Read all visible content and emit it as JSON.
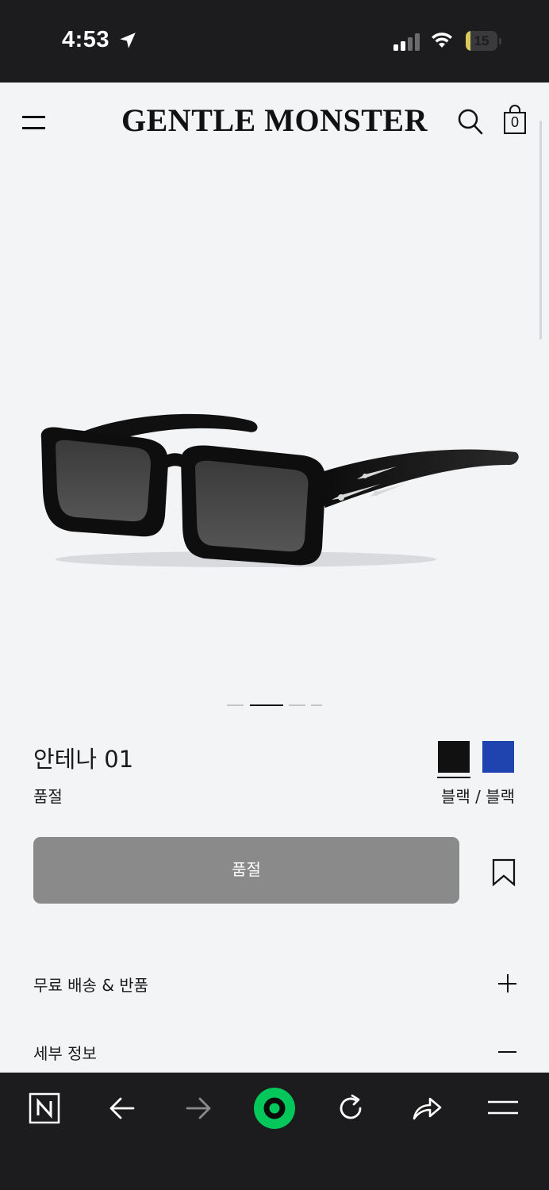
{
  "status_bar": {
    "time": "4:53",
    "battery_level": "15",
    "battery_fraction": 0.15,
    "icons": [
      "location-arrow-icon",
      "cellular-signal-icon",
      "wifi-icon",
      "battery-icon"
    ]
  },
  "header": {
    "logo": "GENTLE MONSTER",
    "cart_count": "0",
    "icons": [
      "hamburger-menu-icon",
      "search-icon",
      "shopping-bag-icon"
    ]
  },
  "product": {
    "name": "안테나 01",
    "stock_status": "품절",
    "color_name": "블랙 / 블랙",
    "image_alt": "sunglasses-product-image",
    "carousel": {
      "count": 4,
      "active_index": 1
    },
    "swatches": [
      {
        "color": "#111111",
        "selected": true
      },
      {
        "color": "#1f44b0",
        "selected": false
      }
    ]
  },
  "actions": {
    "buy_label": "품절",
    "bookmark_icon": "bookmark-icon"
  },
  "accordions": [
    {
      "label": "무료 배송 & 반품",
      "expanded": false
    },
    {
      "label": "세부 정보",
      "expanded": true
    }
  ],
  "browser_toolbar": {
    "icons": [
      "naver-home-icon",
      "back-arrow-icon",
      "forward-arrow-icon",
      "green-dot-icon",
      "reload-icon",
      "share-icon",
      "menu-icon"
    ],
    "accent": "#03c75a"
  }
}
